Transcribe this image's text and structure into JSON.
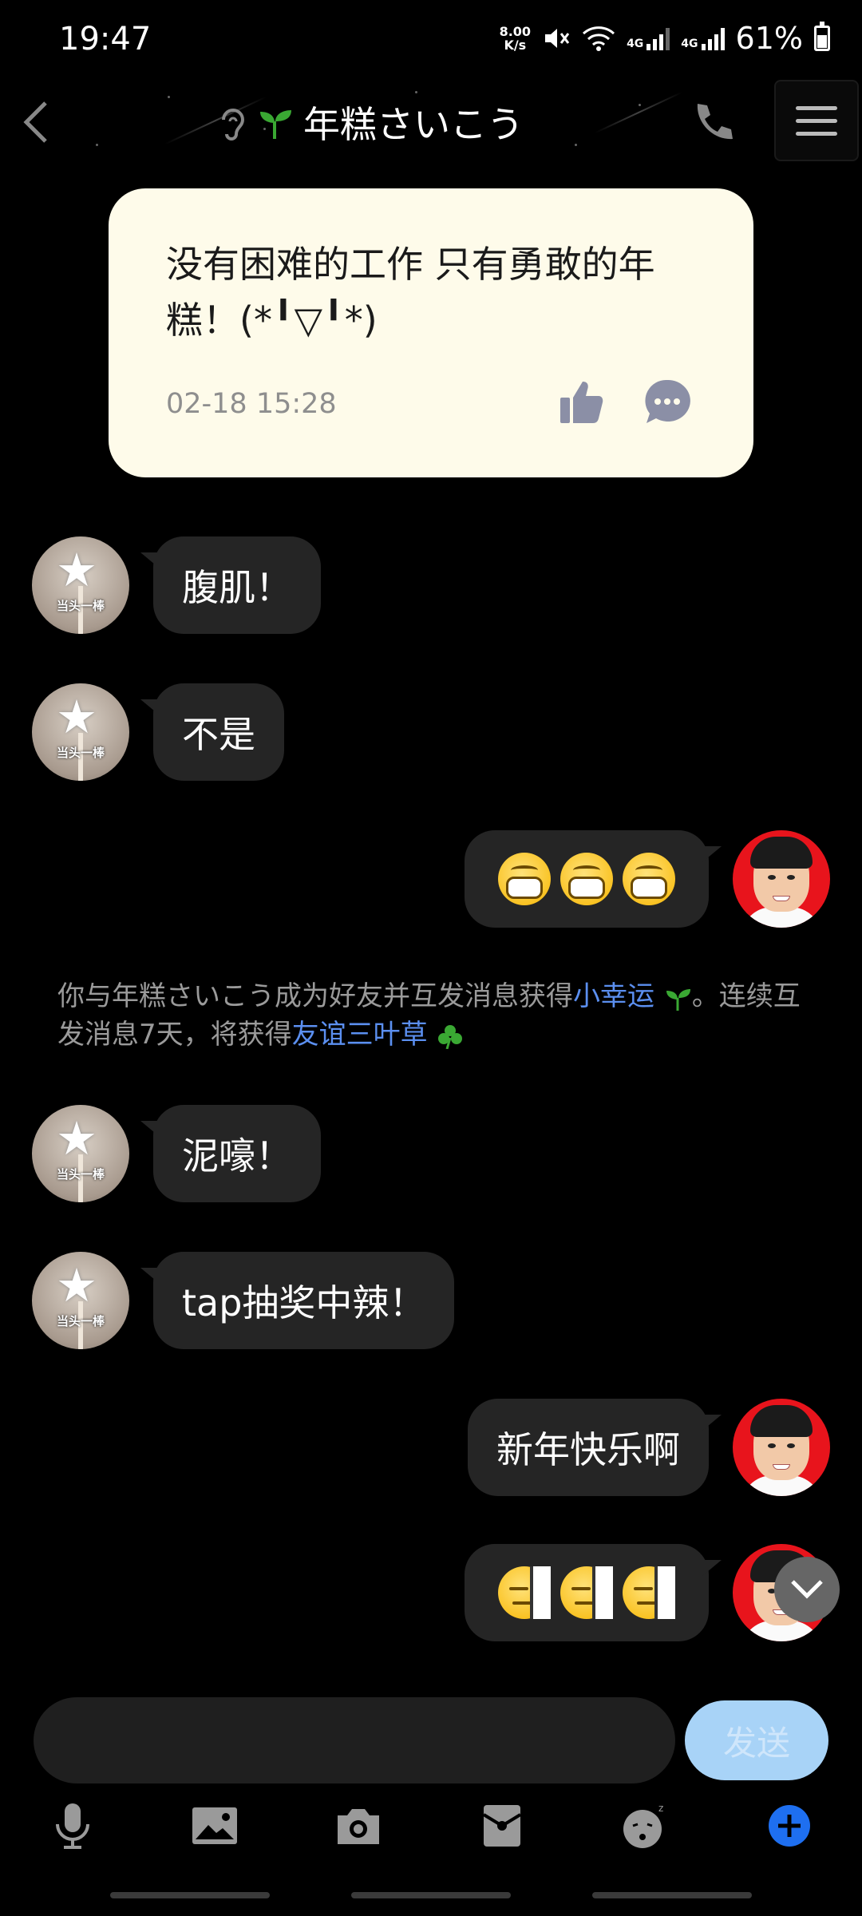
{
  "status_bar": {
    "time": "19:47",
    "net_speed_top": "8.00",
    "net_speed_bottom": "K/s",
    "sim1": "4G",
    "sim2": "4G",
    "battery": "61%"
  },
  "header": {
    "title": "年糕さいこう",
    "icons": [
      "back-icon",
      "ear-icon",
      "sprout-icon",
      "phone-icon",
      "menu-icon"
    ]
  },
  "pinned": {
    "text": "没有困难的工作 只有勇敢的年糕！(*╹▽╹*)",
    "time": "02-18 15:28"
  },
  "messages": [
    {
      "side": "left",
      "text": "腹肌！"
    },
    {
      "side": "left",
      "text": "不是"
    },
    {
      "side": "right",
      "emoji": "grin",
      "count": 3
    },
    {
      "side": "left",
      "text": "泥嚎！"
    },
    {
      "side": "left",
      "text": "tap抽奖中辣！"
    },
    {
      "side": "right",
      "text": "新年快乐啊"
    },
    {
      "side": "right",
      "emoji": "sly",
      "count": 3
    }
  ],
  "avatar_left_caption": "当头一棒",
  "system": {
    "part1": "你与年糕さいこう成为好友并互发消息获得",
    "link1": "小幸运",
    "part2": "。连续互发消息7天，将获得",
    "link2": "友谊三叶草"
  },
  "input": {
    "value": "",
    "send_label": "发送"
  },
  "colors": {
    "pinned_bg": "#fefbea",
    "bubble_bg": "#252525",
    "link": "#5b8ff0",
    "send_bg": "#a8d3f7",
    "plus_blue": "#1e6ff0",
    "sprout_green": "#3aa833"
  },
  "toolbar_icons": [
    "mic-icon",
    "image-icon",
    "camera-icon",
    "red-packet-icon",
    "emoji-icon",
    "plus-icon"
  ]
}
